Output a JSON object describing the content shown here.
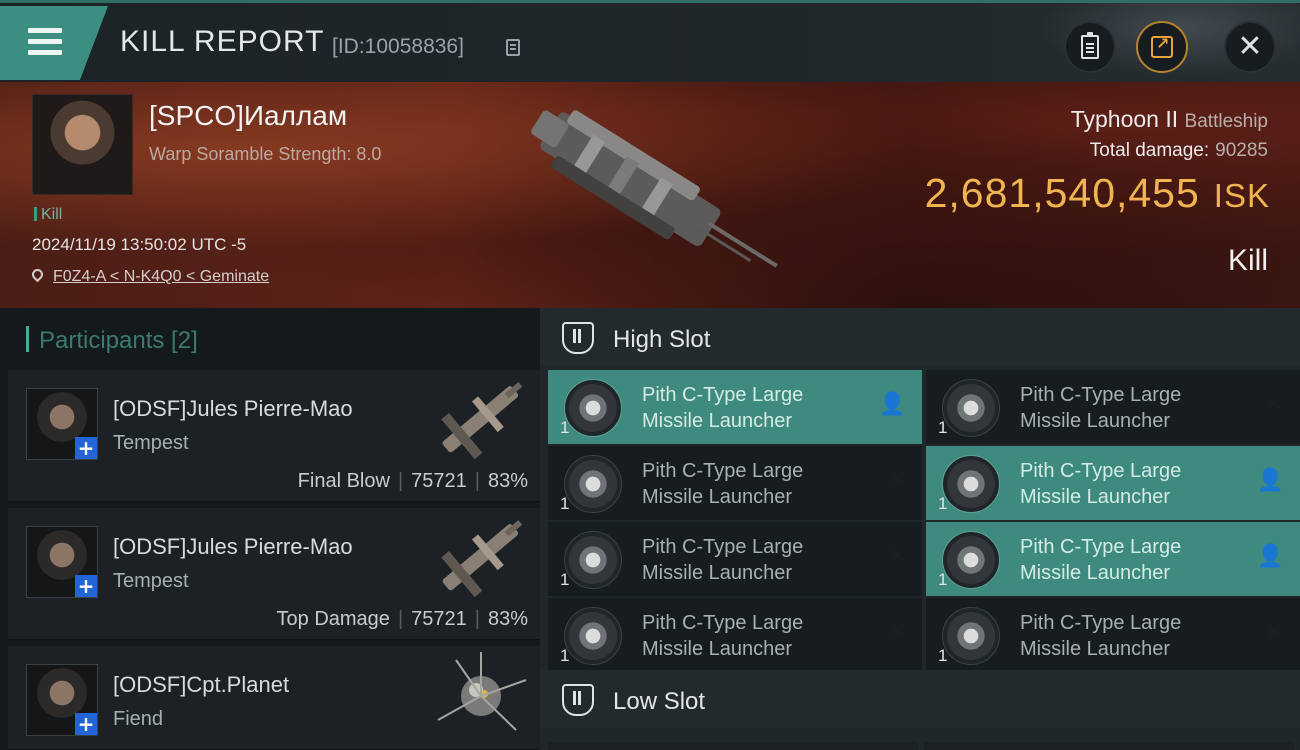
{
  "header": {
    "title": "KILL REPORT",
    "kill_id": "[ID:10058836]",
    "menu_icon": "hamburger-icon",
    "actions": [
      "clipboard-icon",
      "share-icon",
      "close-icon"
    ],
    "accent": "#3b8f80"
  },
  "victim": {
    "name": "[SPCO]Иаллам",
    "warp_scramble": "Warp Soramble Strength: 8.0",
    "tag": "Kill",
    "datetime": "2024/11/19 13:50:02 UTC -5",
    "location": "F0Z4-A < N-K4Q0 < Geminate",
    "ship": "Typhoon II",
    "ship_class": "Battleship",
    "total_damage_label": "Total damage:",
    "total_damage": "90285",
    "isk_value": "2,681,540,455",
    "isk_unit": "ISK",
    "result": "Kill",
    "isk_color": "#f0b450"
  },
  "participants": {
    "header": "Participants [2]",
    "items": [
      {
        "name": "[ODSF]Jules Pierre-Mao",
        "ship": "Tempest",
        "role": "Final Blow",
        "damage": "75721",
        "percent": "83%"
      },
      {
        "name": "[ODSF]Jules Pierre-Mao",
        "ship": "Tempest",
        "role": "Top Damage",
        "damage": "75721",
        "percent": "83%"
      },
      {
        "name": "[ODSF]Cpt.Planet",
        "ship": "Fiend"
      }
    ]
  },
  "slots": {
    "high": {
      "title": "High Slot",
      "modules": [
        {
          "name": "Pith C-Type Large Missile Launcher",
          "qty": "1",
          "status": "dropped",
          "status_icon": "person-icon"
        },
        {
          "name": "Pith C-Type Large Missile Launcher",
          "qty": "1",
          "status": "destroyed",
          "status_icon": "x-icon"
        },
        {
          "name": "Pith C-Type Large Missile Launcher",
          "qty": "1",
          "status": "destroyed",
          "status_icon": "x-icon"
        },
        {
          "name": "Pith C-Type Large Missile Launcher",
          "qty": "1",
          "status": "dropped",
          "status_icon": "person-icon"
        },
        {
          "name": "Pith C-Type Large Missile Launcher",
          "qty": "1",
          "status": "destroyed",
          "status_icon": "x-icon"
        },
        {
          "name": "Pith C-Type Large Missile Launcher",
          "qty": "1",
          "status": "dropped",
          "status_icon": "person-icon"
        },
        {
          "name": "Pith C-Type Large Missile Launcher",
          "qty": "1",
          "status": "destroyed",
          "status_icon": "x-icon"
        },
        {
          "name": "Pith C-Type Large Missile Launcher",
          "qty": "1",
          "status": "destroyed",
          "status_icon": "x-icon"
        }
      ]
    },
    "low": {
      "title": "Low Slot"
    }
  }
}
